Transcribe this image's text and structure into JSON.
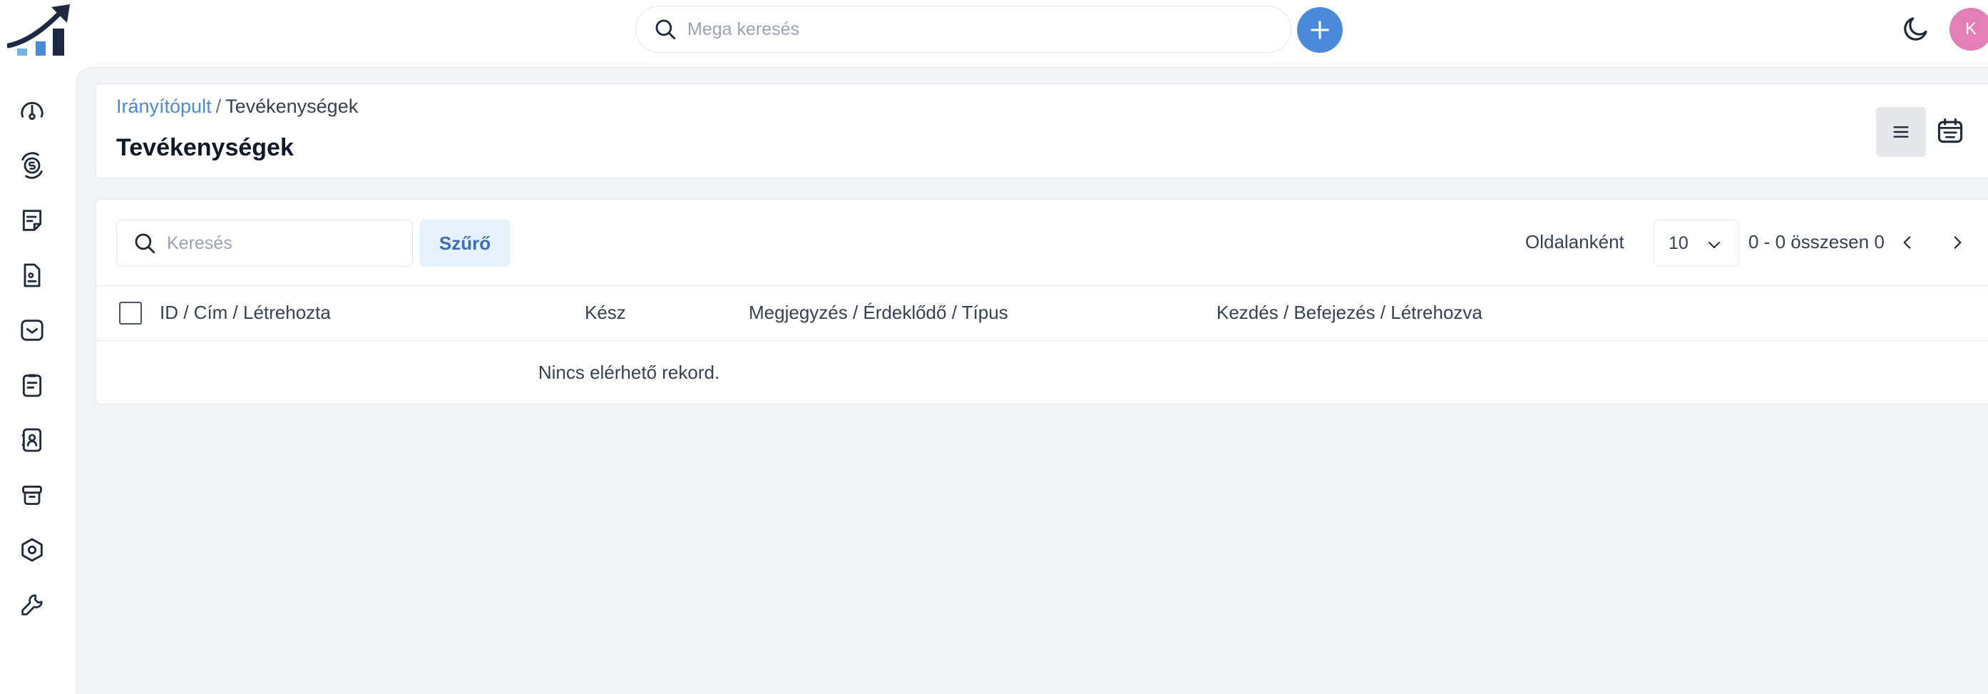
{
  "topbar": {
    "search_placeholder": "Mega keresés",
    "add_button_icon": "plus-icon",
    "theme_icon": "moon-icon",
    "avatar_initial": "K",
    "colors": {
      "accent": "#4a8bd9",
      "avatar": "#e27fb5"
    }
  },
  "sidebar": {
    "items": [
      {
        "icon": "dashboard-gauge-icon"
      },
      {
        "icon": "deals-money-icon"
      },
      {
        "icon": "notes-icon"
      },
      {
        "icon": "document-icon"
      },
      {
        "icon": "mail-icon"
      },
      {
        "icon": "activity-clipboard-icon"
      },
      {
        "icon": "contacts-book-icon"
      },
      {
        "icon": "products-box-icon"
      },
      {
        "icon": "settings-hexagon-icon"
      },
      {
        "icon": "tools-wrench-icon"
      }
    ]
  },
  "header": {
    "breadcrumb_link": "Irányítópult",
    "breadcrumb_separator": "/",
    "breadcrumb_current": "Tevékenységek",
    "title": "Tevékenységek"
  },
  "toolbar": {
    "search_placeholder": "Keresés",
    "filter_label": "Szűrő",
    "per_page_label": "Oldalanként",
    "per_page_value": "10",
    "range_text": "0 - 0 összesen 0"
  },
  "table": {
    "columns": [
      "ID / Cím / Létrehozta",
      "Kész",
      "Megjegyzés / Érdeklődő / Típus",
      "Kezdés / Befejezés / Létrehozva"
    ],
    "rows": [],
    "empty_message": "Nincs elérhető rekord."
  }
}
